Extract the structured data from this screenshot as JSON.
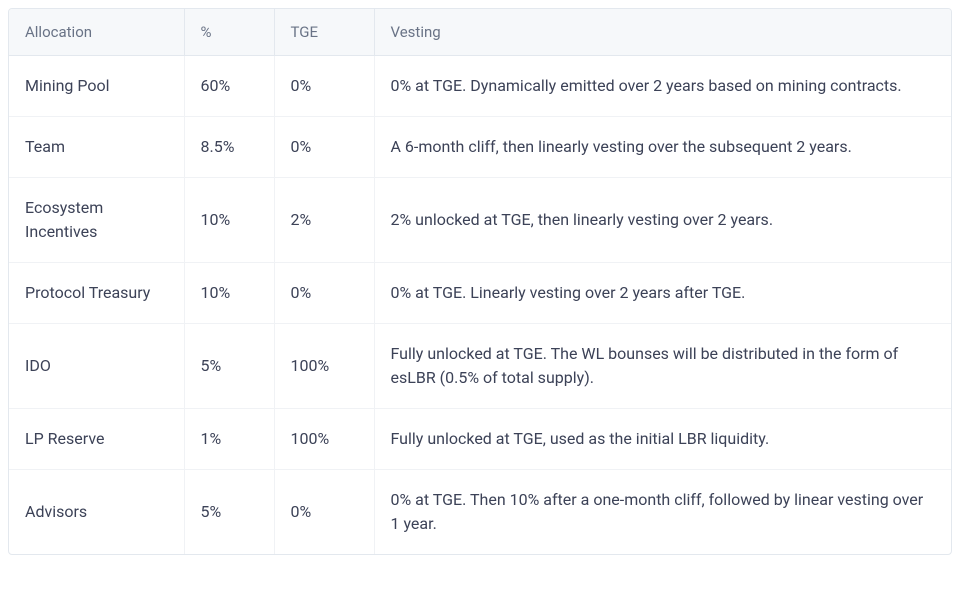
{
  "table": {
    "headers": {
      "allocation": "Allocation",
      "percent": "%",
      "tge": "TGE",
      "vesting": "Vesting"
    },
    "rows": [
      {
        "allocation": "Mining Pool",
        "percent": "60%",
        "tge": "0%",
        "vesting": "0% at TGE. Dynamically emitted over 2 years based on mining contracts."
      },
      {
        "allocation": "Team",
        "percent": "8.5%",
        "tge": "0%",
        "vesting": "A 6-month cliff, then linearly vesting over the subsequent 2 years."
      },
      {
        "allocation": "Ecosystem Incentives",
        "percent": "10%",
        "tge": "2%",
        "vesting": "2% unlocked at TGE, then linearly vesting over 2 years."
      },
      {
        "allocation": "Protocol Treasury",
        "percent": "10%",
        "tge": "0%",
        "vesting": "0% at TGE. Linearly vesting over 2 years after TGE."
      },
      {
        "allocation": "IDO",
        "percent": "5%",
        "tge": "100%",
        "vesting": "Fully unlocked at TGE. The WL bounses will be distributed in the form of esLBR (0.5% of total supply)."
      },
      {
        "allocation": "LP Reserve",
        "percent": "1%",
        "tge": "100%",
        "vesting": "Fully unlocked at TGE, used as the initial LBR liquidity."
      },
      {
        "allocation": "Advisors",
        "percent": "5%",
        "tge": "0%",
        "vesting": "0% at TGE. Then 10% after a one-month cliff, followed by linear vesting over 1 year."
      }
    ]
  }
}
